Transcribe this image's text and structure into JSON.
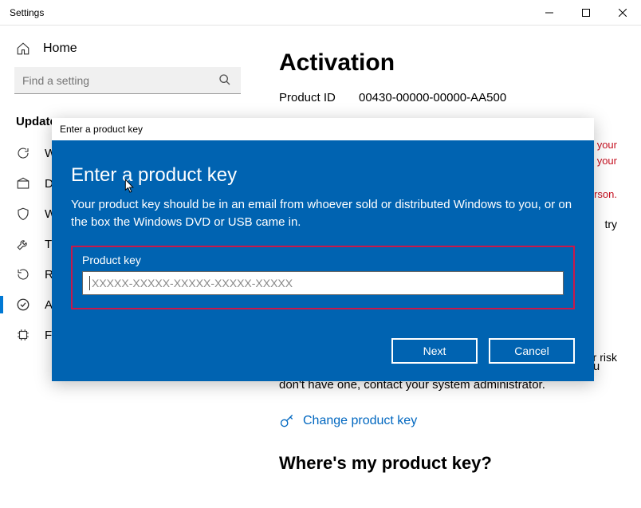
{
  "titlebar": {
    "title": "Settings"
  },
  "sidebar": {
    "home": "Home",
    "search_placeholder": "Find a setting",
    "section": "Update",
    "items": [
      {
        "label": "W"
      },
      {
        "label": "De"
      },
      {
        "label": "W"
      },
      {
        "label": "Tr"
      },
      {
        "label": "Re"
      },
      {
        "label": "Activation"
      },
      {
        "label": "For developers"
      }
    ]
  },
  "main": {
    "heading": "Activation",
    "product_id_label": "Product ID",
    "product_id_value": "00430-00000-00000-AA500",
    "warn_line1": "your",
    "warn_line2": "your",
    "warn_line3": "erson.",
    "try": "try",
    "risk": "r risk",
    "help_text": "To get genuine Windows, enter a different product key. If you don't have one, contact your system administrator.",
    "change_key_link": "Change product key",
    "sub_heading": "Where's my product key?"
  },
  "dialog": {
    "titlebar": "Enter a product key",
    "heading": "Enter a product key",
    "description": "Your product key should be in an email from whoever sold or distributed Windows to you, or on the box the Windows DVD or USB came in.",
    "field_label": "Product key",
    "placeholder": "XXXXX-XXXXX-XXXXX-XXXXX-XXXXX",
    "next": "Next",
    "cancel": "Cancel"
  }
}
